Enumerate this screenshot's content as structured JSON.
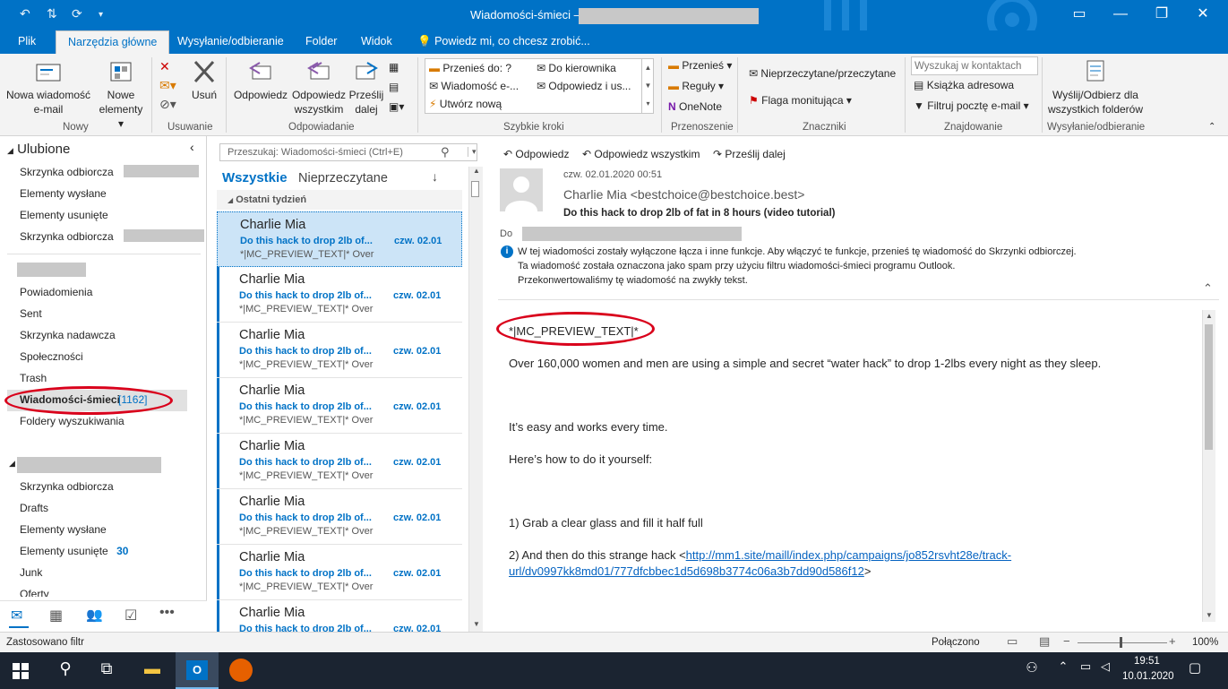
{
  "window": {
    "title": "Wiadomości-śmieci —"
  },
  "tabs": [
    {
      "label": "Plik"
    },
    {
      "label": "Narzędzia główne"
    },
    {
      "label": "Wysyłanie/odbieranie"
    },
    {
      "label": "Folder"
    },
    {
      "label": "Widok"
    },
    {
      "label": "Powiedz mi, co chcesz zrobić..."
    }
  ],
  "ribbon": {
    "new_email": [
      "Nowa wiadomość",
      "e-mail"
    ],
    "new_items": [
      "Nowe",
      "elementy"
    ],
    "group_new": "Nowy",
    "delete": "Usuń",
    "group_delete": "Usuwanie",
    "reply": "Odpowiedz",
    "reply_all": [
      "Odpowiedz",
      "wszystkim"
    ],
    "forward": [
      "Prześlij",
      "dalej"
    ],
    "group_respond": "Odpowiadanie",
    "quick_steps": [
      "Przenieś do: ?",
      "Do kierownika",
      "Wiadomość e-...",
      "Odpowiedz i us...",
      "Utwórz nową"
    ],
    "group_quick": "Szybkie kroki",
    "move": "Przenieś",
    "rules": "Reguły",
    "onenote": "OneNote",
    "group_move": "Przenoszenie",
    "unread_read": "Nieprzeczytane/przeczytane",
    "follow_up": "Flaga monitująca",
    "group_tags": "Znaczniki",
    "search_contacts": "Wyszukaj w kontaktach",
    "address_book": "Książka adresowa",
    "filter_email": "Filtruj pocztę e-mail",
    "group_find": "Znajdowanie",
    "send_receive_all": [
      "Wyślij/Odbierz dla",
      "wszystkich folderów"
    ],
    "group_sendreceive": "Wysyłanie/odbieranie"
  },
  "nav": {
    "favorites": "Ulubione",
    "fav_items": [
      "Skrzynka odbiorcza",
      "Elementy wysłane",
      "Elementy usunięte",
      "Skrzynka odbiorcza"
    ],
    "account1_items": [
      "Powiadomienia",
      "Sent",
      "Skrzynka nadawcza",
      "Społeczności",
      "Trash"
    ],
    "junk_label": "Wiadomości-śmieci",
    "junk_count": "[1162]",
    "search_folders": "Foldery wyszukiwania",
    "account2_items": [
      "Skrzynka odbiorcza",
      "Drafts",
      "Elementy wysłane",
      "Elementy usunięte",
      "Junk",
      "Oferty"
    ],
    "deleted_count": "30"
  },
  "list": {
    "search_placeholder": "Przeszukaj: Wiadomości-śmieci (Ctrl+E)",
    "filter_all": "Wszystkie",
    "filter_unread": "Nieprzeczytane",
    "group_header": "Ostatni tydzień",
    "messages": [
      {
        "from": "Charlie Mia",
        "subject": "Do this hack to drop 2lb of...",
        "date": "czw. 02.01",
        "preview": "*|MC_PREVIEW_TEXT|*   Over"
      },
      {
        "from": "Charlie Mia",
        "subject": "Do this hack to drop 2lb of...",
        "date": "czw. 02.01",
        "preview": "*|MC_PREVIEW_TEXT|*   Over"
      },
      {
        "from": "Charlie Mia",
        "subject": "Do this hack to drop 2lb of...",
        "date": "czw. 02.01",
        "preview": "*|MC_PREVIEW_TEXT|*   Over"
      },
      {
        "from": "Charlie Mia",
        "subject": "Do this hack to drop 2lb of...",
        "date": "czw. 02.01",
        "preview": "*|MC_PREVIEW_TEXT|*   Over"
      },
      {
        "from": "Charlie Mia",
        "subject": "Do this hack to drop 2lb of...",
        "date": "czw. 02.01",
        "preview": "*|MC_PREVIEW_TEXT|*   Over"
      },
      {
        "from": "Charlie Mia",
        "subject": "Do this hack to drop 2lb of...",
        "date": "czw. 02.01",
        "preview": "*|MC_PREVIEW_TEXT|*   Over"
      },
      {
        "from": "Charlie Mia",
        "subject": "Do this hack to drop 2lb of...",
        "date": "czw. 02.01",
        "preview": "*|MC_PREVIEW_TEXT|*   Over"
      },
      {
        "from": "Charlie Mia",
        "subject": "Do this hack to drop 2lb of...",
        "date": "czw. 02.01",
        "preview": ""
      }
    ]
  },
  "reading": {
    "reply": "Odpowiedz",
    "reply_all": "Odpowiedz wszystkim",
    "forward": "Prześlij dalej",
    "datetime": "czw. 02.01.2020 00:51",
    "sender": "Charlie Mia <bestchoice@bestchoice.best>",
    "subject": "Do this hack to drop 2lb of fat in 8 hours (video tutorial)",
    "to_label": "Do",
    "info": [
      "W tej wiadomości zostały wyłączone łącza i inne funkcje. Aby włączyć te funkcje, przenieś tę wiadomość do Skrzynki odbiorczej.",
      "Ta wiadomość została oznaczona jako spam przy użyciu filtru wiadomości-śmieci programu Outlook.",
      "Przekonwertowaliśmy tę wiadomość na zwykły tekst."
    ],
    "body": {
      "preview_tag": "*|MC_PREVIEW_TEXT|*",
      "p1": "Over 160,000 women and men are using a simple and secret “water hack” to drop 1-2lbs every night as they sleep.",
      "p2": "It’s easy and works every time.",
      "p3": "Here’s how to do it yourself:",
      "p4": "1) Grab a clear glass and fill it half full",
      "p5_prefix": "2) And then do this strange hack <",
      "p5_link1": "http://mm1.site/maill/index.php/campaigns/jo852rsvht28e/track-",
      "p5_link2": "url/dv0997kk8md01/777dfcbbec1d5d698b3774c06a3b7dd90d586f12",
      "p5_suffix": ">"
    }
  },
  "status": {
    "left": "Zastosowano filtr",
    "connected": "Połączono",
    "zoom": "100%"
  },
  "taskbar": {
    "time": "19:51",
    "date": "10.01.2020"
  },
  "colors": {
    "accent": "#0072c6",
    "highlight": "#d9001b"
  }
}
